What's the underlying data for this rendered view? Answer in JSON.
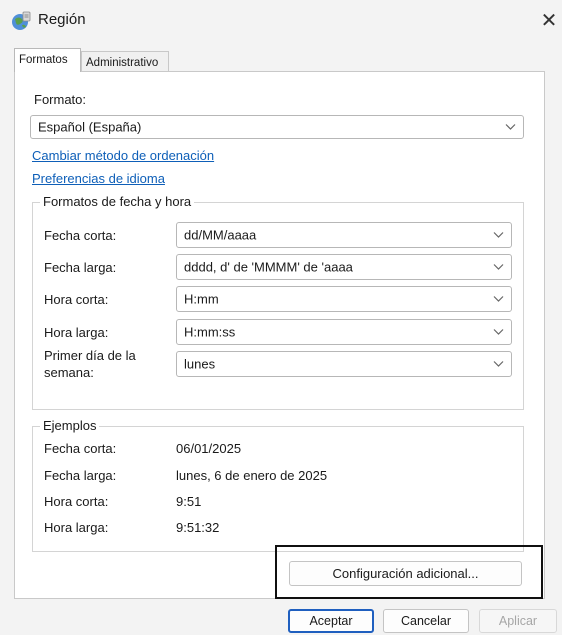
{
  "window": {
    "title": "Región",
    "close_glyph": "✕"
  },
  "tabs": [
    {
      "label": "Formatos",
      "active": true
    },
    {
      "label": "Administrativo",
      "active": false
    }
  ],
  "format": {
    "label": "Formato:",
    "value": "Español (España)"
  },
  "links": {
    "sort_method": "Cambiar método de ordenación",
    "language_prefs": "Preferencias de idioma"
  },
  "date_time": {
    "group_label": "Formatos de fecha y hora",
    "short_date": {
      "label": "Fecha corta:",
      "value": "dd/MM/aaaa"
    },
    "long_date": {
      "label": "Fecha larga:",
      "value": "dddd, d' de 'MMMM' de 'aaaa"
    },
    "short_time": {
      "label": "Hora corta:",
      "value": "H:mm"
    },
    "long_time": {
      "label": "Hora larga:",
      "value": "H:mm:ss"
    },
    "first_day": {
      "label_line1": "Primer día de la",
      "label_line2": "semana:",
      "value": "lunes"
    }
  },
  "examples": {
    "group_label": "Ejemplos",
    "short_date": {
      "label": "Fecha corta:",
      "value": "06/01/2025"
    },
    "long_date": {
      "label": "Fecha larga:",
      "value": "lunes, 6 de enero de 2025"
    },
    "short_time": {
      "label": "Hora corta:",
      "value": "9:51"
    },
    "long_time": {
      "label": "Hora larga:",
      "value": "9:51:32"
    }
  },
  "buttons": {
    "additional": "Configuración adicional...",
    "ok": "Aceptar",
    "cancel": "Cancelar",
    "apply": "Aplicar"
  },
  "colors": {
    "link": "#0e5fb8",
    "primary_border": "#1f5fbf",
    "highlight_border": "#101010"
  },
  "icons": {
    "title": "globe-region-icon",
    "dropdown": "chevron-down-icon",
    "close": "close-icon"
  }
}
